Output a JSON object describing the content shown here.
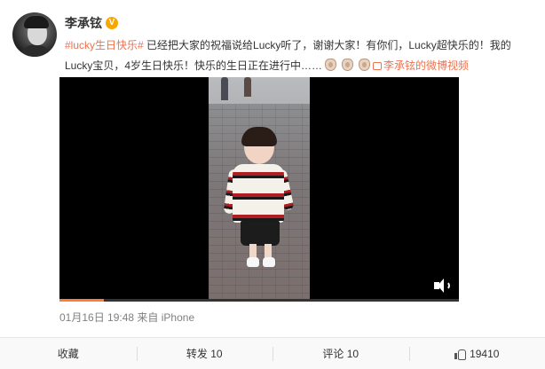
{
  "user": {
    "name": "李承铉",
    "verified_badge": "V"
  },
  "post": {
    "hashtag": "#lucky生日快乐#",
    "text_1": " 已经把大家的祝福说给Lucky听了，谢谢大家！有你们，Lucky超快乐的！我的Lucky宝贝，4岁生日快乐！快乐的生日正在进行中……",
    "emojis": [
      "rabbit-emoji",
      "rabbit-emoji",
      "rabbit-emoji"
    ],
    "video_link": "李承铉的微博视频"
  },
  "video": {
    "progress_fraction": 0.11
  },
  "meta": {
    "timestamp": "01月16日 19:48",
    "source_prefix": "来自",
    "source": "iPhone"
  },
  "actions": {
    "favorite": "收藏",
    "repost": "转发 10",
    "comment": "评论 10",
    "like": "19410"
  },
  "colors": {
    "accent": "#eb7350",
    "verified": "#f7a700",
    "progress": "#fa7d3c"
  }
}
